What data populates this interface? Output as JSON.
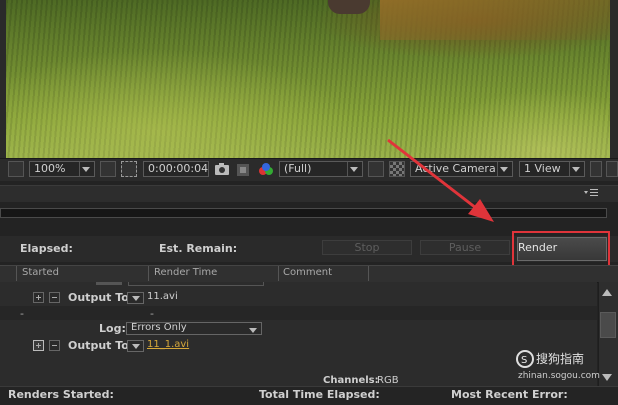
{
  "viewer": {
    "zoom": "100%",
    "timecode": "0:00:00:04",
    "resolution": "(Full)",
    "camera": "Active Camera",
    "view_layout": "1 View"
  },
  "render_status": {
    "elapsed_label": "Elapsed:",
    "est_remain_label": "Est. Remain:",
    "stop_label": "Stop",
    "pause_label": "Pause",
    "render_label": "Render"
  },
  "queue": {
    "columns": [
      "Started",
      "Render Time",
      "Comment"
    ],
    "item1": {
      "log_label": "Log:",
      "output_label": "Output To:",
      "output_file": "11.avi",
      "dash1": "-",
      "dash2": "-"
    },
    "item2": {
      "log_label": "Log:",
      "log_value": "Errors Only",
      "output_label": "Output To:",
      "output_file": "11_1.avi"
    },
    "channels_label": "Channels:",
    "channels_value": "RGB"
  },
  "footer": {
    "renders_started": "Renders Started:",
    "total_time_elapsed": "Total Time Elapsed:",
    "most_recent_error": "Most Recent Error:"
  },
  "watermark": {
    "brand": "搜狗指南",
    "url": "zhinan.sogou.com"
  },
  "colors": {
    "highlight": "#e0343a",
    "link": "#d6a83a",
    "arrow": "#e0343a"
  }
}
